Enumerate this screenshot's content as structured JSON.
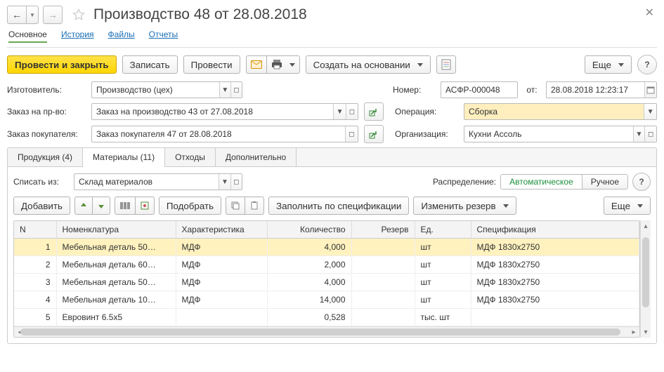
{
  "title": "Производство 48 от 28.08.2018",
  "link_tabs": {
    "main": "Основное",
    "history": "История",
    "files": "Файлы",
    "reports": "Отчеты"
  },
  "toolbar": {
    "post_close": "Провести и закрыть",
    "save": "Записать",
    "post": "Провести",
    "create_based": "Создать на основании",
    "more": "Еще"
  },
  "fields": {
    "manufacturer_label": "Изготовитель:",
    "manufacturer_value": "Производство (цех)",
    "number_label": "Номер:",
    "number_value": "АСФР-000048",
    "date_label": "от:",
    "date_value": "28.08.2018 12:23:17",
    "prod_order_label": "Заказ на пр-во:",
    "prod_order_value": "Заказ на производство 43 от 27.08.2018",
    "operation_label": "Операция:",
    "operation_value": "Сборка",
    "cust_order_label": "Заказ покупателя:",
    "cust_order_value": "Заказ покупателя 47 от 28.08.2018",
    "org_label": "Организация:",
    "org_value": "Кухни Ассоль"
  },
  "notebook": {
    "tab_products": "Продукция (4)",
    "tab_materials": "Материалы (11)",
    "tab_waste": "Отходы",
    "tab_additional": "Дополнительно"
  },
  "materials": {
    "writeoff_label": "Списать из:",
    "writeoff_value": "Склад материалов",
    "distribution_label": "Распределение:",
    "distribution_auto": "Автоматическое",
    "distribution_manual": "Ручное",
    "add": "Добавить",
    "pick": "Подобрать",
    "fill_by_spec": "Заполнить по спецификации",
    "change_reserve": "Изменить резерв",
    "more": "Еще"
  },
  "table": {
    "headers": {
      "n": "N",
      "nomen": "Номенклатура",
      "char": "Характеристика",
      "qty": "Количество",
      "reserve": "Резерв",
      "unit": "Ед.",
      "spec": "Спецификация"
    },
    "rows": [
      {
        "n": "1",
        "nomen": "Мебельная деталь 50…",
        "char": "МДФ",
        "qty": "4,000",
        "reserve": "",
        "unit": "шт",
        "spec": "МДФ 1830x2750"
      },
      {
        "n": "2",
        "nomen": "Мебельная деталь 60…",
        "char": "МДФ",
        "qty": "2,000",
        "reserve": "",
        "unit": "шт",
        "spec": "МДФ 1830x2750"
      },
      {
        "n": "3",
        "nomen": "Мебельная деталь 50…",
        "char": "МДФ",
        "qty": "4,000",
        "reserve": "",
        "unit": "шт",
        "spec": "МДФ 1830x2750"
      },
      {
        "n": "4",
        "nomen": "Мебельная деталь 10…",
        "char": "МДФ",
        "qty": "14,000",
        "reserve": "",
        "unit": "шт",
        "spec": "МДФ 1830x2750"
      },
      {
        "n": "5",
        "nomen": "Евровинт 6.5x5",
        "char": "",
        "qty": "0,528",
        "reserve": "",
        "unit": "тыс. шт",
        "spec": ""
      }
    ]
  }
}
